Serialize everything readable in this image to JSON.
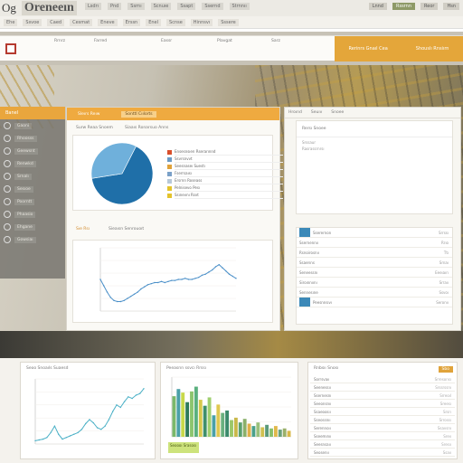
{
  "app": {
    "logo_text": "Og",
    "brand": "Oreneeın"
  },
  "topbar": {
    "items": [
      "Lsdrı",
      "Pnd",
      "Ssrnı",
      "Scnuıe",
      "Ssapt",
      "Ssernd",
      "Strnnıı"
    ],
    "right": [
      "Lnnd",
      "Rssrnn",
      "Reor",
      "Hsn"
    ]
  },
  "subbar": {
    "items": [
      "Ehe",
      "Ssvoe",
      "Caed",
      "Cesmat",
      "Eneve",
      "Erssn",
      "Enel",
      "Scnse",
      "Hinnsvı",
      "Sssere"
    ]
  },
  "filterbar": {
    "fields": [
      "Rrnrz",
      "Farred",
      "Eassr",
      "Plavgat",
      "Sarz"
    ],
    "orange_buttons": [
      "Rerinrs Gnaıl Cea",
      "Shouslı Rnsiırn"
    ]
  },
  "sidebar": {
    "header": "Banel",
    "items": [
      "Gaoni",
      "Rhoosss",
      "Geewsnt",
      "Renwkd",
      "Srnalı",
      "Sesıoe",
      "Poorntt",
      "Phaasio",
      "Ehgane",
      "Gowsiaı"
    ]
  },
  "main_panel": {
    "tabs": [
      "Sleırs Reıw",
      "Sonttl Cıılorts"
    ],
    "pie_title": "Surw Reaa Snoem",
    "pie_subtitle": "Siaaıs Ronarsuo Anns",
    "line_title": "Sıe Rsı",
    "line_subtitle": "Sieaısn Senrouoıt"
  },
  "pie_legend": [
    {
      "label": "Ensesnsıen Rserarınnd",
      "color": "#d94f2b"
    },
    {
      "label": "Ssvrsnvvt",
      "color": "#6b9bc6"
    },
    {
      "label": "Seesnaseı Suestı",
      "color": "#e0a23a"
    },
    {
      "label": "Fserrsaısı",
      "color": "#7aa0c8"
    },
    {
      "label": "Ersrnn Roseass",
      "color": "#b7c8d8"
    },
    {
      "label": "Pelnisevo Pesı",
      "color": "#e4c32c"
    },
    {
      "label": "Ssınevnı Rsvt",
      "color": "#e4c32c"
    }
  ],
  "right_panel": {
    "header": [
      "Hroınd",
      "Seuıv",
      "Snoee"
    ],
    "card1_title": "Rersı Snoee",
    "card1_rows": [
      "Srssaur",
      "Rasrassrnrsı"
    ],
    "card2_rows": [
      {
        "t": "Sserernon",
        "v": "Srrssı"
      },
      {
        "t": "Ssernennıı",
        "v": "Rrıo"
      },
      {
        "t": "Rsnoirosnıı",
        "v": "Ttı"
      },
      {
        "t": "Ssaerıns",
        "v": "Srnaı"
      },
      {
        "t": "Seneessnı",
        "v": "Eeeıaırı"
      },
      {
        "t": "Siroınnıını",
        "v": "Srraıı"
      },
      {
        "t": "Sennesıne",
        "v": "Ssvoı"
      },
      {
        "t": "Peesnnsıvı",
        "v": "Seronıı"
      }
    ]
  },
  "bottom": {
    "card1_title": "Seoo Snoaıls Suaesd",
    "card2_title": "Peeasrın ssvcı Rrssı",
    "card3_title": "Rnbsıı Snosı",
    "card3_badge": "Sbo",
    "green_note": "Seoooı Srasosı",
    "tasks": [
      {
        "t": "Sorrsvaıı",
        "v": "Srresonsı"
      },
      {
        "t": "Seenessıı",
        "v": "Srssrssnı"
      },
      {
        "t": "Ssernesnı",
        "v": "Srreoıl"
      },
      {
        "t": "Seeonsnıı",
        "v": "Sreesı"
      },
      {
        "t": "Ssaeoosıı",
        "v": "Srsrı"
      },
      {
        "t": "Sseossnıı",
        "v": "Srrossı"
      },
      {
        "t": "Serennoıı",
        "v": "Ssavsnı"
      },
      {
        "t": "Sseemınıı",
        "v": "Sreıı"
      },
      {
        "t": "Seesnsaıı",
        "v": "Sresıı"
      },
      {
        "t": "Seosenıı",
        "v": "Ssaıı"
      }
    ]
  },
  "chart_data": [
    {
      "type": "pie",
      "values": [
        65,
        35
      ],
      "colors": [
        "#1f6fa8",
        "#6fb0db"
      ]
    },
    {
      "type": "line",
      "x": [
        0,
        1,
        2,
        3,
        4,
        5,
        6,
        7,
        8,
        9,
        10,
        11,
        12,
        13,
        14,
        15,
        16,
        17,
        18,
        19,
        20,
        21,
        22,
        23,
        24,
        25,
        26,
        27,
        28,
        29,
        30,
        31,
        32,
        33,
        34,
        35,
        36,
        37,
        38,
        39,
        40
      ],
      "values": [
        30,
        24,
        18,
        13,
        10,
        9,
        9,
        10,
        12,
        14,
        16,
        18,
        21,
        23,
        25,
        26,
        27,
        27,
        28,
        27,
        28,
        29,
        29,
        30,
        30,
        31,
        30,
        30,
        31,
        32,
        34,
        35,
        37,
        39,
        42,
        44,
        41,
        38,
        35,
        33,
        31
      ],
      "ylim": [
        0,
        60
      ],
      "color": "#4a8fc8"
    },
    {
      "type": "line",
      "x": [
        0,
        1,
        2,
        3,
        4,
        5,
        6,
        7,
        8,
        9,
        10,
        11,
        12,
        13,
        14,
        15,
        16,
        17,
        18,
        19,
        20,
        21,
        22,
        23,
        24,
        25,
        26,
        27,
        28
      ],
      "values": [
        4,
        5,
        6,
        8,
        14,
        22,
        12,
        6,
        8,
        10,
        12,
        14,
        18,
        25,
        30,
        26,
        20,
        18,
        22,
        30,
        40,
        48,
        45,
        52,
        58,
        56,
        60,
        62,
        68
      ],
      "ylim": [
        0,
        80
      ],
      "color": "#4ab0c6"
    },
    {
      "type": "bar",
      "values": [
        34,
        40,
        37,
        29,
        38,
        42,
        31,
        26,
        33,
        18,
        27,
        20,
        22,
        14,
        16,
        12,
        15,
        11,
        9,
        12,
        8,
        10,
        7,
        9,
        6,
        7,
        5
      ],
      "colors": [
        "#7ab86a",
        "#4aa0a8",
        "#c8d84a",
        "#2e7a5a",
        "#8cc56e",
        "#5ab07e",
        "#d7c84a",
        "#3f8f6a",
        "#9fcf6e",
        "#4aa0a8",
        "#e0c850",
        "#6ab07e",
        "#3a8a6a",
        "#9cc86a",
        "#c9b84a",
        "#5aa06e",
        "#8ab06a",
        "#e0b04a",
        "#4aa08a",
        "#9ac07a",
        "#d0c050",
        "#5a9a7a",
        "#8ac06a",
        "#e0b84a",
        "#6aa07a",
        "#9ab06a",
        "#d8b84a"
      ],
      "ylim": [
        0,
        50
      ]
    }
  ]
}
